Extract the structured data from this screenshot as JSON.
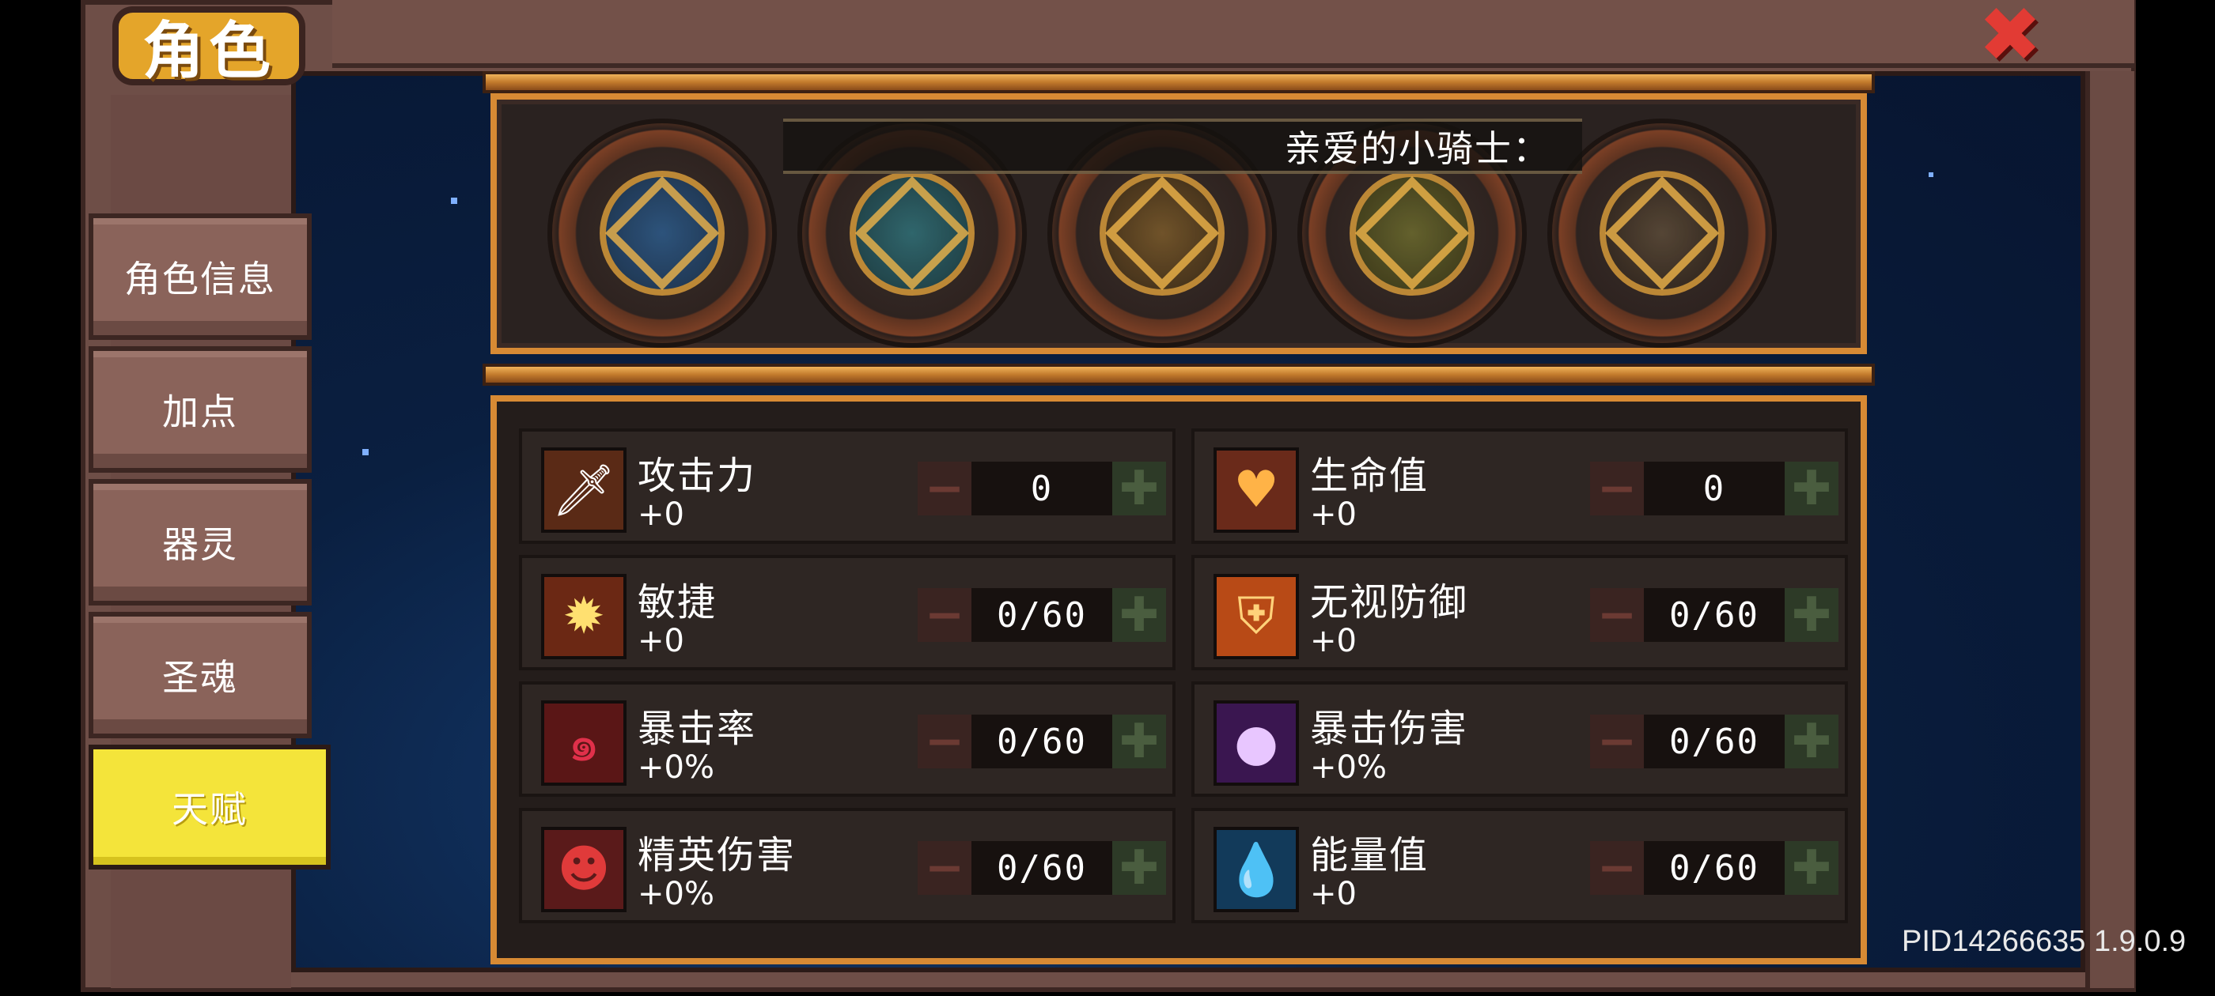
{
  "header": {
    "title": "角色",
    "close_icon": "close-x-icon"
  },
  "nav": {
    "tabs": [
      {
        "label": "角色信息"
      },
      {
        "label": "加点"
      },
      {
        "label": "器灵"
      },
      {
        "label": "圣魂"
      },
      {
        "label": "天赋",
        "active": true
      }
    ]
  },
  "talents": {
    "banner_text": "亲爱的小骑士：",
    "medals": [
      "ocean-medal-icon",
      "wave-medal-icon",
      "flame-medal-icon",
      "earth-medal-icon",
      "holy-medal-icon"
    ]
  },
  "stats": [
    {
      "name": "攻击力",
      "bonus": "+0",
      "value": "0",
      "icon": "sword-icon"
    },
    {
      "name": "生命值",
      "bonus": "+0",
      "value": "0",
      "icon": "heart-icon"
    },
    {
      "name": "敏捷",
      "bonus": "+0",
      "value": "0/60",
      "icon": "sun-burst-icon"
    },
    {
      "name": "无视防御",
      "bonus": "+0",
      "value": "0/60",
      "icon": "broken-shield-icon"
    },
    {
      "name": "暴击率",
      "bonus": "+0%",
      "value": "0/60",
      "icon": "red-swirl-icon"
    },
    {
      "name": "暴击伤害",
      "bonus": "+0%",
      "value": "0/60",
      "icon": "purple-orb-icon"
    },
    {
      "name": "精英伤害",
      "bonus": "+0%",
      "value": "0/60",
      "icon": "demon-face-icon"
    },
    {
      "name": "能量值",
      "bonus": "+0",
      "value": "0/60",
      "icon": "water-drop-icon"
    }
  ],
  "controls": {
    "minus_label": "−",
    "plus_label": "✚"
  },
  "footer": {
    "version": "PID14266635 1.9.0.9"
  }
}
